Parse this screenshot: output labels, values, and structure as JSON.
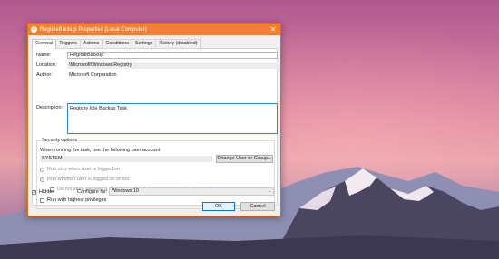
{
  "window": {
    "title": "RegIdleBackup Properties (Local Computer)",
    "close_glyph": "✕"
  },
  "tabs": [
    "General",
    "Triggers",
    "Actions",
    "Conditions",
    "Settings",
    "History (disabled)"
  ],
  "general": {
    "name_label": "Name:",
    "name_value": "RegIdleBackup",
    "location_label": "Location:",
    "location_value": "\\Microsoft\\Windows\\Registry",
    "author_label": "Author:",
    "author_value": "Microsoft Corporation",
    "description_label": "Description:",
    "description_value": "Registry Idle Backup Task"
  },
  "security": {
    "legend": "Security options",
    "user_account_prompt": "When running the task, use the following user account:",
    "user_account_value": "SYSTEM",
    "change_user_button": "Change User or Group...",
    "radio_logged_on": "Run only when user is logged on",
    "radio_logged_on_or_not": "Run whether user is logged on or not",
    "check_no_store_password": "Do not store password.  The task will only have access to local computer resources.",
    "check_highest_privileges": "Run with highest privileges"
  },
  "footer": {
    "hidden_label": "Hidden",
    "hidden_checked": true,
    "configure_label": "Configure for:",
    "configure_value": "Windows 10",
    "ok_button": "OK",
    "cancel_button": "Cancel"
  },
  "colors": {
    "titlebar": "#f08033",
    "focus_border": "#3b7fd4"
  }
}
